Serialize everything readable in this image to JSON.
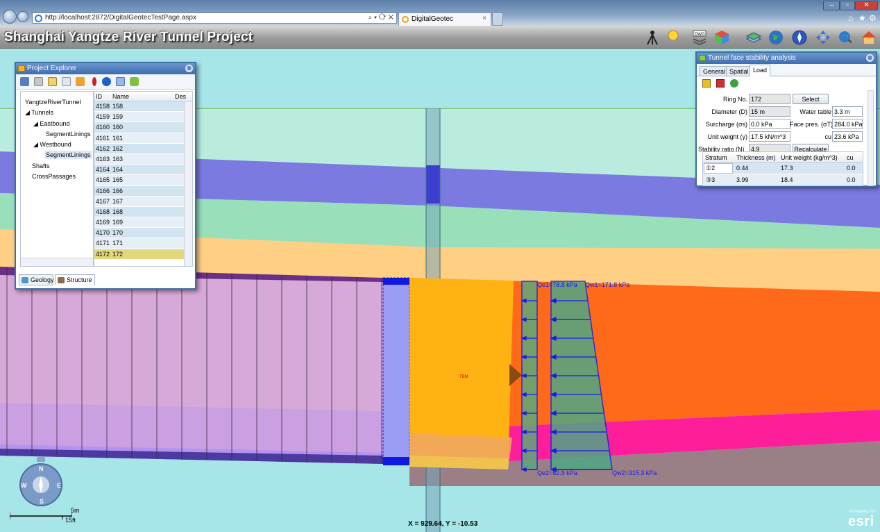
{
  "browser": {
    "url": "http://localhost:2872/DigitalGeotecTestPage.aspx",
    "address_actions": "⌕ ▾ ⟳ ✕",
    "tab_title": "DigitalGeotec",
    "tab_close": "×"
  },
  "app": {
    "title": "Shanghai Yangtze River Tunnel Project"
  },
  "project_explorer": {
    "title": "Project Explorer",
    "tree": [
      {
        "label": "YangtzeRiverTunnel"
      },
      {
        "label": "◢ Tunnels"
      },
      {
        "label": "◢ Eastbound"
      },
      {
        "label": "SegmentLinings"
      },
      {
        "label": "◢ Westbound"
      },
      {
        "label": "SegmentLinings"
      },
      {
        "label": "Shafts"
      },
      {
        "label": "CrossPassages"
      }
    ],
    "grid": {
      "headers": {
        "id": "ID",
        "name": "Name",
        "desc": "Des"
      },
      "rows": [
        {
          "id": "4158",
          "name": "158"
        },
        {
          "id": "4159",
          "name": "159"
        },
        {
          "id": "4160",
          "name": "160"
        },
        {
          "id": "4161",
          "name": "161"
        },
        {
          "id": "4162",
          "name": "162"
        },
        {
          "id": "4163",
          "name": "163"
        },
        {
          "id": "4164",
          "name": "164"
        },
        {
          "id": "4165",
          "name": "165"
        },
        {
          "id": "4166",
          "name": "166"
        },
        {
          "id": "4167",
          "name": "167"
        },
        {
          "id": "4168",
          "name": "168"
        },
        {
          "id": "4169",
          "name": "169"
        },
        {
          "id": "4170",
          "name": "170"
        },
        {
          "id": "4171",
          "name": "171"
        },
        {
          "id": "4172",
          "name": "172"
        }
      ],
      "selected_id": "4172"
    },
    "tabs": {
      "geology": "Geology",
      "structure": "Structure"
    },
    "active_tab": "Structure"
  },
  "tunnel_face": {
    "title": "Tunnel face stability analysis",
    "tabs": [
      "General",
      "Spatial",
      "Load"
    ],
    "active_tab": "Load",
    "fields": {
      "ring_no_label": "Ring No.",
      "ring_no": "172",
      "select_button": "Select",
      "diameter_label": "Diameter (D)",
      "diameter": "15 m",
      "water_table_label": "Water table",
      "water_table": "3.3 m",
      "surcharge_label": "Surcharge (σs)",
      "surcharge": "0.0 kPa",
      "face_pres_label": "Face pres. (σT)",
      "face_pres": "284.0 kPa",
      "unit_weight_label": "Unit weight (γ)",
      "unit_weight": "17.5 kN/m^3",
      "cu_label": "cu",
      "cu": "23.6 kPa",
      "stability_label": "Stability ratio (N)",
      "stability": "4.9",
      "recalc_button": "Recalculate"
    },
    "strata": {
      "headers": [
        "Stratum",
        "Thickness (m)",
        "Unit weight (kg/m^3)",
        "cu"
      ],
      "rows": [
        [
          "①2",
          "0.44",
          "17.3",
          "0.0"
        ],
        [
          "③3",
          "3.99",
          "18.4",
          "0.0"
        ]
      ]
    }
  },
  "map": {
    "tbm_label": "TBM",
    "qe1": "Qe1=78.8 kPa",
    "qw1": "Qw1=171.8 kPa",
    "qe2": "Qe2=82.9 kPa",
    "qw2": "Qw2=315.3 kPa",
    "coordinate_readout": "X = 929.64, Y = -10.53",
    "scale_metric": "5m",
    "scale_imperial": "15ft",
    "compass": {
      "n": "N",
      "s": "S",
      "e": "E",
      "w": "W"
    },
    "esri_powered": "POWERED BY",
    "esri": "esri"
  },
  "colors": {
    "header_bg": "#9c9c9c",
    "window_border": "#3f6ea8",
    "selected_row": "#e3d77c",
    "load_blue": "#1a1ae6"
  }
}
